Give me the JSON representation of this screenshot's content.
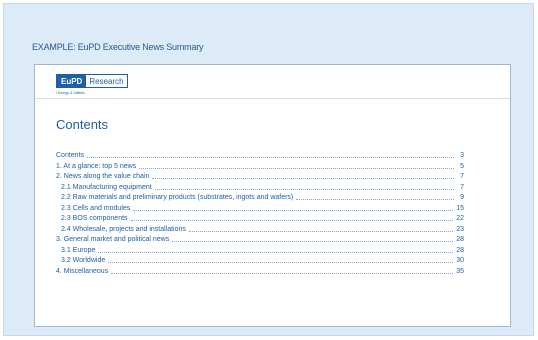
{
  "caption": "EXAMPLE: EuPD Executive News Summary",
  "logo": {
    "left": "EuPD",
    "right": "Research",
    "sub": "I Energy & Utilities"
  },
  "title": "Contents",
  "toc": [
    {
      "text": "Contents",
      "page": "3",
      "sub": false
    },
    {
      "text": "1. At a glance: top 5 news",
      "page": "5",
      "sub": false
    },
    {
      "text": "2. News along the value chain",
      "page": "7",
      "sub": false
    },
    {
      "text": "2.1 Manufacturing equipment",
      "page": "7",
      "sub": true
    },
    {
      "text": "2.2 Raw materials and preliminary products (substrates, ingots and wafers)",
      "page": "9",
      "sub": true
    },
    {
      "text": "2.3 Cells and modules",
      "page": "15",
      "sub": true
    },
    {
      "text": "2.3 BOS components",
      "page": "22",
      "sub": true
    },
    {
      "text": "2.4 Wholesale, projects and installations",
      "page": "23",
      "sub": true
    },
    {
      "text": "3. General market and political news",
      "page": "28",
      "sub": false
    },
    {
      "text": "3.1 Europe",
      "page": "28",
      "sub": true
    },
    {
      "text": "3.2 Worldwide",
      "page": "30",
      "sub": true
    },
    {
      "text": "4. Miscellaneous",
      "page": "35",
      "sub": false
    }
  ]
}
